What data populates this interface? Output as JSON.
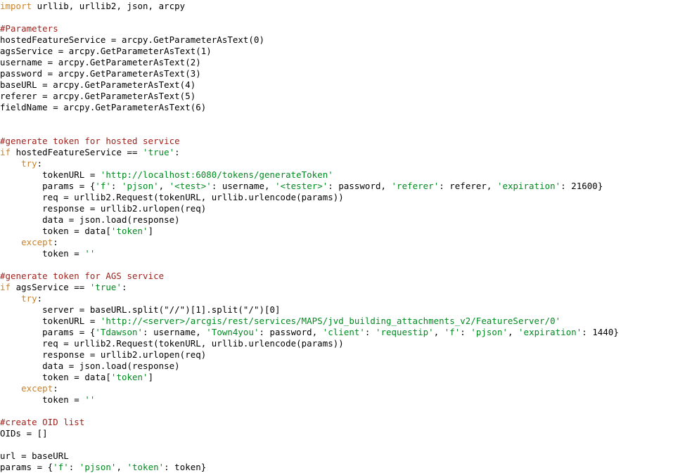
{
  "editor": {
    "language": "Python",
    "background_color": "#ffffff",
    "colors": {
      "keyword": "#c8822c",
      "comment": "#9e1f19",
      "string": "#008a1f",
      "plain": "#000000"
    }
  },
  "code": {
    "lines": [
      {
        "id": "line-1",
        "tokens": [
          {
            "t": "kw",
            "v": "import"
          },
          {
            "t": "plain",
            "v": " urllib, urllib2, json, arcpy"
          }
        ]
      },
      {
        "id": "line-2",
        "tokens": []
      },
      {
        "id": "line-3",
        "tokens": [
          {
            "t": "comment",
            "v": "#Parameters"
          }
        ]
      },
      {
        "id": "line-4",
        "tokens": [
          {
            "t": "plain",
            "v": "hostedFeatureService = arcpy.GetParameterAsText(0)"
          }
        ]
      },
      {
        "id": "line-5",
        "tokens": [
          {
            "t": "plain",
            "v": "agsService = arcpy.GetParameterAsText(1)"
          }
        ]
      },
      {
        "id": "line-6",
        "tokens": [
          {
            "t": "plain",
            "v": "username = arcpy.GetParameterAsText(2)"
          }
        ]
      },
      {
        "id": "line-7",
        "tokens": [
          {
            "t": "plain",
            "v": "password = arcpy.GetParameterAsText(3)"
          }
        ]
      },
      {
        "id": "line-8",
        "tokens": [
          {
            "t": "plain",
            "v": "baseURL = arcpy.GetParameterAsText(4)"
          }
        ]
      },
      {
        "id": "line-9",
        "tokens": [
          {
            "t": "plain",
            "v": "referer = arcpy.GetParameterAsText(5)"
          }
        ]
      },
      {
        "id": "line-10",
        "tokens": [
          {
            "t": "plain",
            "v": "fieldName = arcpy.GetParameterAsText(6)"
          }
        ]
      },
      {
        "id": "line-11",
        "tokens": []
      },
      {
        "id": "line-12",
        "tokens": []
      },
      {
        "id": "line-13",
        "tokens": [
          {
            "t": "comment",
            "v": "#generate token for hosted service"
          }
        ]
      },
      {
        "id": "line-14",
        "tokens": [
          {
            "t": "kw",
            "v": "if"
          },
          {
            "t": "plain",
            "v": " hostedFeatureService == "
          },
          {
            "t": "string",
            "v": "'true'"
          },
          {
            "t": "plain",
            "v": ":"
          }
        ]
      },
      {
        "id": "line-15",
        "tokens": [
          {
            "t": "plain",
            "v": "    "
          },
          {
            "t": "kw",
            "v": "try"
          },
          {
            "t": "plain",
            "v": ":"
          }
        ]
      },
      {
        "id": "line-16",
        "tokens": [
          {
            "t": "plain",
            "v": "        tokenURL = "
          },
          {
            "t": "string",
            "v": "'http://localhost:6080/tokens/generateToken'"
          }
        ]
      },
      {
        "id": "line-17",
        "tokens": [
          {
            "t": "plain",
            "v": "        params = {"
          },
          {
            "t": "string",
            "v": "'f'"
          },
          {
            "t": "plain",
            "v": ": "
          },
          {
            "t": "string",
            "v": "'pjson'"
          },
          {
            "t": "plain",
            "v": ", "
          },
          {
            "t": "string",
            "v": "'<test>'"
          },
          {
            "t": "plain",
            "v": ": username, "
          },
          {
            "t": "string",
            "v": "'<tester>'"
          },
          {
            "t": "plain",
            "v": ": password, "
          },
          {
            "t": "string",
            "v": "'referer'"
          },
          {
            "t": "plain",
            "v": ": referer, "
          },
          {
            "t": "string",
            "v": "'expiration'"
          },
          {
            "t": "plain",
            "v": ": 21600}"
          }
        ]
      },
      {
        "id": "line-18",
        "tokens": [
          {
            "t": "plain",
            "v": "        req = urllib2.Request(tokenURL, urllib.urlencode(params))"
          }
        ]
      },
      {
        "id": "line-19",
        "tokens": [
          {
            "t": "plain",
            "v": "        response = urllib2.urlopen(req)"
          }
        ]
      },
      {
        "id": "line-20",
        "tokens": [
          {
            "t": "plain",
            "v": "        data = json.load(response)"
          }
        ]
      },
      {
        "id": "line-21",
        "tokens": [
          {
            "t": "plain",
            "v": "        token = data["
          },
          {
            "t": "string",
            "v": "'token'"
          },
          {
            "t": "plain",
            "v": "]"
          }
        ]
      },
      {
        "id": "line-22",
        "tokens": [
          {
            "t": "plain",
            "v": "    "
          },
          {
            "t": "kw",
            "v": "except"
          },
          {
            "t": "plain",
            "v": ":"
          }
        ]
      },
      {
        "id": "line-23",
        "tokens": [
          {
            "t": "plain",
            "v": "        token = "
          },
          {
            "t": "string",
            "v": "''"
          }
        ]
      },
      {
        "id": "line-24",
        "tokens": []
      },
      {
        "id": "line-25",
        "tokens": [
          {
            "t": "comment",
            "v": "#generate token for AGS service"
          }
        ]
      },
      {
        "id": "line-26",
        "tokens": [
          {
            "t": "kw",
            "v": "if"
          },
          {
            "t": "plain",
            "v": " agsService == "
          },
          {
            "t": "string",
            "v": "'true'"
          },
          {
            "t": "plain",
            "v": ":"
          }
        ]
      },
      {
        "id": "line-27",
        "tokens": [
          {
            "t": "plain",
            "v": "    "
          },
          {
            "t": "kw",
            "v": "try"
          },
          {
            "t": "plain",
            "v": ":"
          }
        ]
      },
      {
        "id": "line-28",
        "tokens": [
          {
            "t": "plain",
            "v": "        server = baseURL.split(\"//\")[1].split(\"/\")[0]"
          }
        ]
      },
      {
        "id": "line-29",
        "tokens": [
          {
            "t": "plain",
            "v": "        tokenURL = "
          },
          {
            "t": "string",
            "v": "'http://<server>/arcgis/rest/services/MAPS/jvd_building_attachments_v2/FeatureServer/0'"
          }
        ]
      },
      {
        "id": "line-30",
        "tokens": [
          {
            "t": "plain",
            "v": "        params = {"
          },
          {
            "t": "string",
            "v": "'Tdawson'"
          },
          {
            "t": "plain",
            "v": ": username, "
          },
          {
            "t": "string",
            "v": "'Town4you'"
          },
          {
            "t": "plain",
            "v": ": password, "
          },
          {
            "t": "string",
            "v": "'client'"
          },
          {
            "t": "plain",
            "v": ": "
          },
          {
            "t": "string",
            "v": "'requestip'"
          },
          {
            "t": "plain",
            "v": ", "
          },
          {
            "t": "string",
            "v": "'f'"
          },
          {
            "t": "plain",
            "v": ": "
          },
          {
            "t": "string",
            "v": "'pjson'"
          },
          {
            "t": "plain",
            "v": ", "
          },
          {
            "t": "string",
            "v": "'expiration'"
          },
          {
            "t": "plain",
            "v": ": 1440}"
          }
        ]
      },
      {
        "id": "line-31",
        "tokens": [
          {
            "t": "plain",
            "v": "        req = urllib2.Request(tokenURL, urllib.urlencode(params))"
          }
        ]
      },
      {
        "id": "line-32",
        "tokens": [
          {
            "t": "plain",
            "v": "        response = urllib2.urlopen(req)"
          }
        ]
      },
      {
        "id": "line-33",
        "tokens": [
          {
            "t": "plain",
            "v": "        data = json.load(response)"
          }
        ]
      },
      {
        "id": "line-34",
        "tokens": [
          {
            "t": "plain",
            "v": "        token = data["
          },
          {
            "t": "string",
            "v": "'token'"
          },
          {
            "t": "plain",
            "v": "]"
          }
        ]
      },
      {
        "id": "line-35",
        "tokens": [
          {
            "t": "plain",
            "v": "    "
          },
          {
            "t": "kw",
            "v": "except"
          },
          {
            "t": "plain",
            "v": ":"
          }
        ]
      },
      {
        "id": "line-36",
        "tokens": [
          {
            "t": "plain",
            "v": "        token = "
          },
          {
            "t": "string",
            "v": "''"
          }
        ]
      },
      {
        "id": "line-37",
        "tokens": []
      },
      {
        "id": "line-38",
        "tokens": [
          {
            "t": "comment",
            "v": "#create OID list"
          }
        ]
      },
      {
        "id": "line-39",
        "tokens": [
          {
            "t": "plain",
            "v": "OIDs = []"
          }
        ]
      },
      {
        "id": "line-40",
        "tokens": []
      },
      {
        "id": "line-41",
        "tokens": [
          {
            "t": "plain",
            "v": "url = baseURL"
          }
        ]
      },
      {
        "id": "line-42",
        "tokens": [
          {
            "t": "plain",
            "v": "params = {"
          },
          {
            "t": "string",
            "v": "'f'"
          },
          {
            "t": "plain",
            "v": ": "
          },
          {
            "t": "string",
            "v": "'pjson'"
          },
          {
            "t": "plain",
            "v": ", "
          },
          {
            "t": "string",
            "v": "'token'"
          },
          {
            "t": "plain",
            "v": ": token}"
          }
        ]
      }
    ]
  }
}
